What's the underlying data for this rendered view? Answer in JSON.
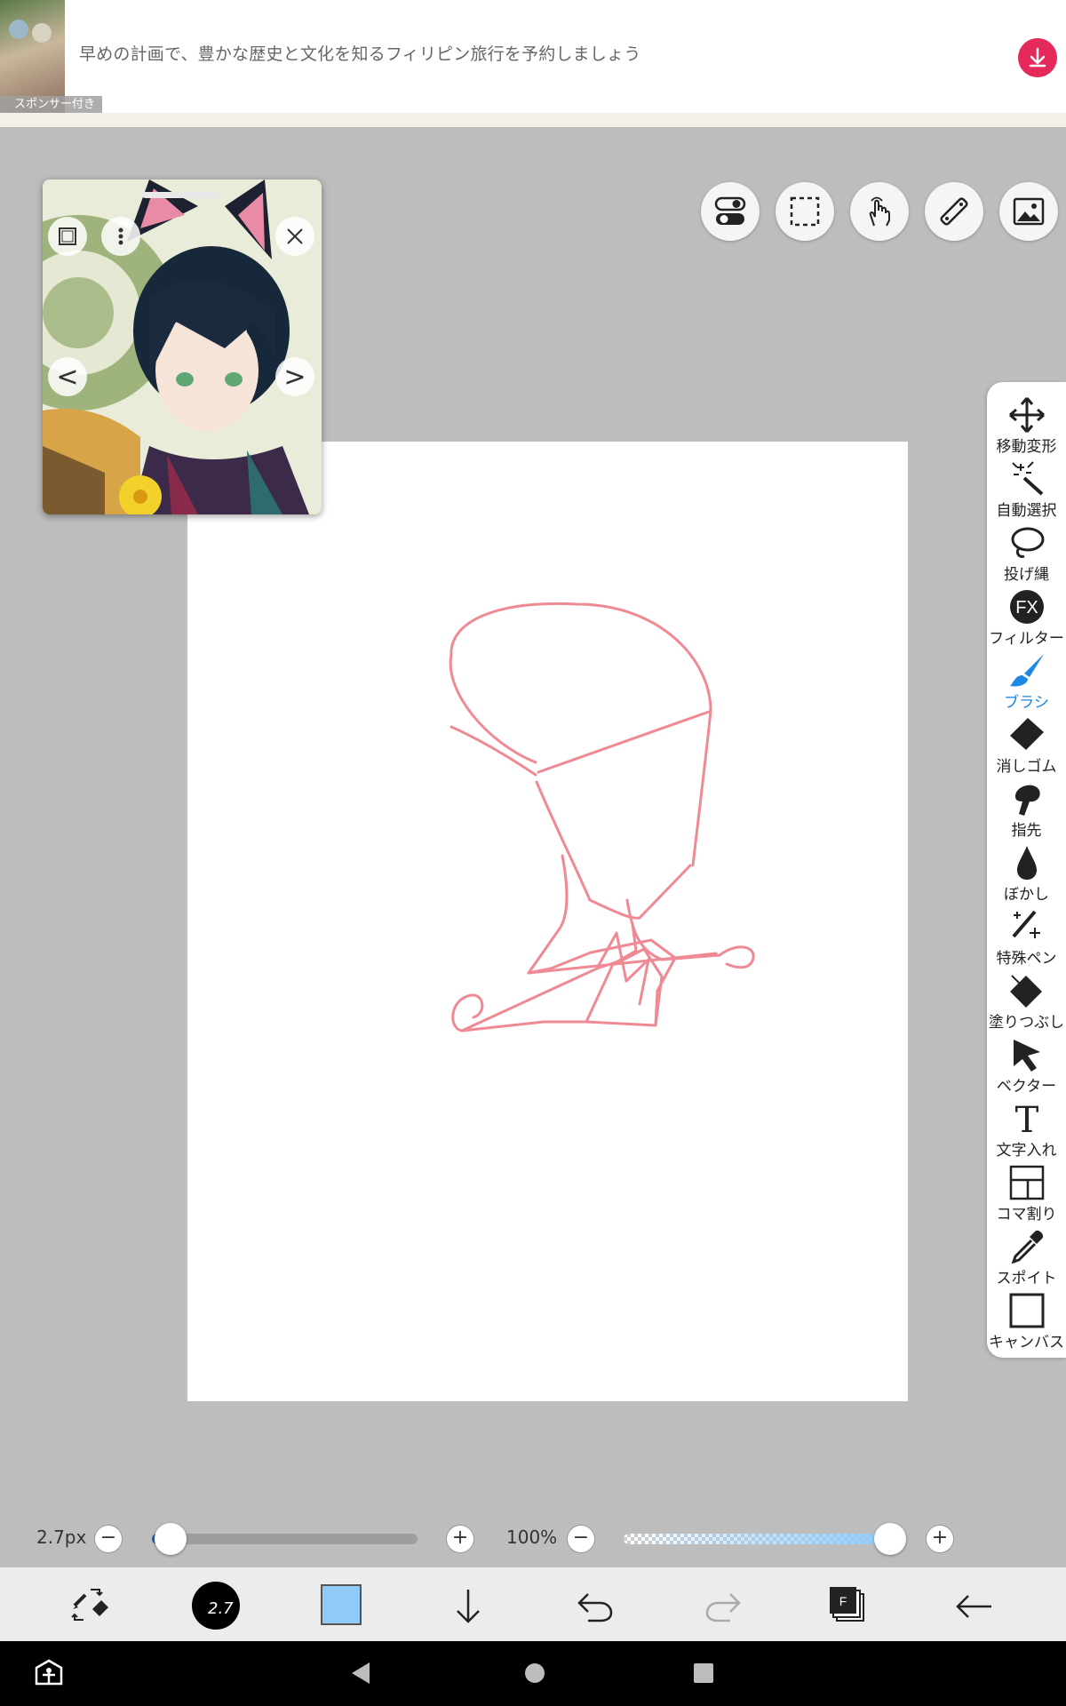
{
  "ad": {
    "text": "早めの計画で、豊かな歴史と文化を知るフィリピン旅行を予約しましょう",
    "sponsor_label": "スポンサー付き"
  },
  "reference_window": {
    "prev_label": "<",
    "next_label": ">"
  },
  "top_toolbar": {
    "buttons": [
      "toggle-icon",
      "selection-icon",
      "hand-icon",
      "ruler-icon",
      "image-icon"
    ]
  },
  "tools": [
    {
      "label": "移動変形",
      "icon": "move-icon"
    },
    {
      "label": "自動選択",
      "icon": "magic-wand-icon"
    },
    {
      "label": "投げ縄",
      "icon": "lasso-icon"
    },
    {
      "label": "フィルター",
      "icon": "fx-icon",
      "badge": "FX"
    },
    {
      "label": "ブラシ",
      "icon": "brush-icon",
      "active": true
    },
    {
      "label": "消しゴム",
      "icon": "eraser-icon"
    },
    {
      "label": "指先",
      "icon": "finger-icon"
    },
    {
      "label": "ぼかし",
      "icon": "blur-icon"
    },
    {
      "label": "特殊ペン",
      "icon": "special-pen-icon"
    },
    {
      "label": "塗りつぶし",
      "icon": "bucket-icon"
    },
    {
      "label": "ベクター",
      "icon": "vector-icon"
    },
    {
      "label": "文字入れ",
      "icon": "text-icon",
      "glyph": "T"
    },
    {
      "label": "コマ割り",
      "icon": "frame-divide-icon"
    },
    {
      "label": "スポイト",
      "icon": "eyedropper-icon"
    },
    {
      "label": "キャンバス",
      "icon": "canvas-icon"
    }
  ],
  "sliders": {
    "brush_size_text": "2.7px",
    "brush_size_fraction": 0.07,
    "opacity_text": "100%",
    "opacity_fraction": 1.0,
    "minus": "−",
    "plus": "+"
  },
  "bottom_bar": {
    "brush_size_badge": "2.7",
    "color": "#90caf9",
    "layer_badge": "F"
  },
  "colors": {
    "accent": "#1e88e5",
    "sketch": "#ef8a95",
    "ad_download": "#e5295a"
  }
}
